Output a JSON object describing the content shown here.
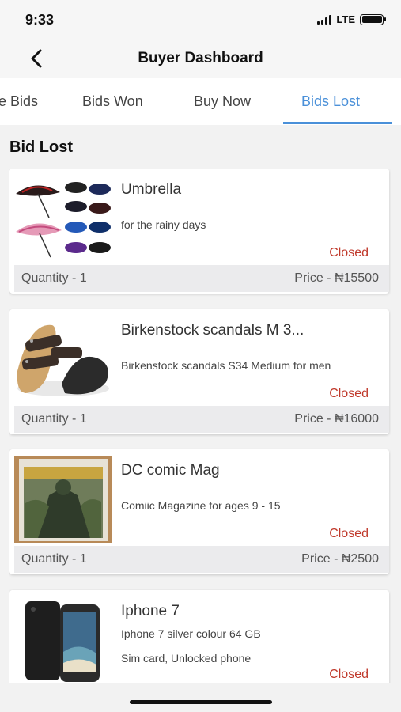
{
  "status_bar": {
    "time": "9:33",
    "network": "LTE"
  },
  "header": {
    "title": "Buyer Dashboard",
    "back_icon": "chevron-left-icon"
  },
  "tabs": [
    {
      "label": "e Bids",
      "active": false
    },
    {
      "label": "Bids Won",
      "active": false
    },
    {
      "label": "Buy Now",
      "active": false
    },
    {
      "label": "Bids Lost",
      "active": true
    }
  ],
  "section_title": "Bid Lost",
  "colors": {
    "accent": "#4a90d9",
    "closed": "#c0392b"
  },
  "items": [
    {
      "name": "Umbrella",
      "description": "for the rainy days",
      "description2": "",
      "status": "Closed",
      "quantity": "Quantity - 1",
      "price": "Price - ₦15500",
      "image": "umbrellas"
    },
    {
      "name": "Birkenstock scandals M 3...",
      "description": "Birkenstock scandals S34 Medium for men",
      "description2": "",
      "status": "Closed",
      "quantity": "Quantity - 1",
      "price": "Price - ₦16000",
      "image": "sandals"
    },
    {
      "name": "DC comic Mag",
      "description": "Comiic Magazine for ages 9 - 15",
      "description2": "",
      "status": "Closed",
      "quantity": "Quantity - 1",
      "price": "Price - ₦2500",
      "image": "comic"
    },
    {
      "name": "Iphone 7",
      "description": "Iphone 7 silver colour 64 GB",
      "description2": "Sim card, Unlocked phone",
      "status": "Closed",
      "quantity": "",
      "price": "",
      "image": "phone"
    }
  ]
}
